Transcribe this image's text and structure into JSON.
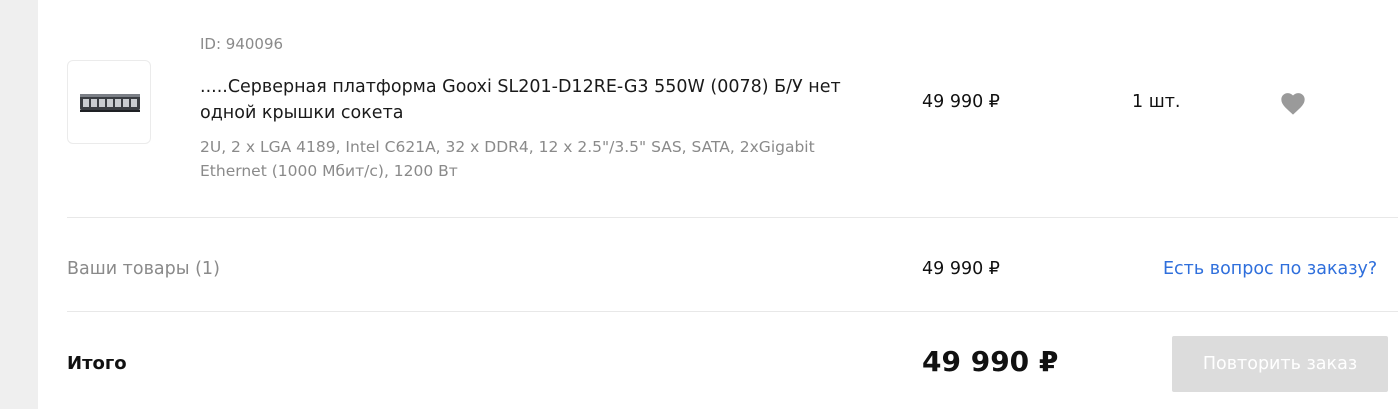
{
  "product": {
    "id_text": "ID: 940096",
    "title": ".....Серверная платформа Gooxi SL201-D12RE-G3 550W (0078) Б/У нет одной крышки сокета",
    "description": "2U, 2 x LGA 4189, Intel C621A, 32 x DDR4, 12 x 2.5\"/3.5\" SAS, SATA, 2xGigabit Ethernet (1000 Мбит/с), 1200 Вт",
    "price": "49 990 ₽",
    "quantity": "1 шт.",
    "image_icon": "server-chassis-icon",
    "favorite_icon": "heart-icon"
  },
  "summary": {
    "items_label": "Ваши товары (1)",
    "items_price": "49 990 ₽",
    "question_link": "Есть вопрос по заказу?"
  },
  "total": {
    "label": "Итого",
    "price": "49 990 ₽",
    "repeat_button": "Повторить заказ"
  },
  "colors": {
    "link": "#2f6fdc",
    "muted_text": "#8a8a8a",
    "disabled_button": "#dcdcdc",
    "favorite_icon": "#9a9a9a"
  }
}
